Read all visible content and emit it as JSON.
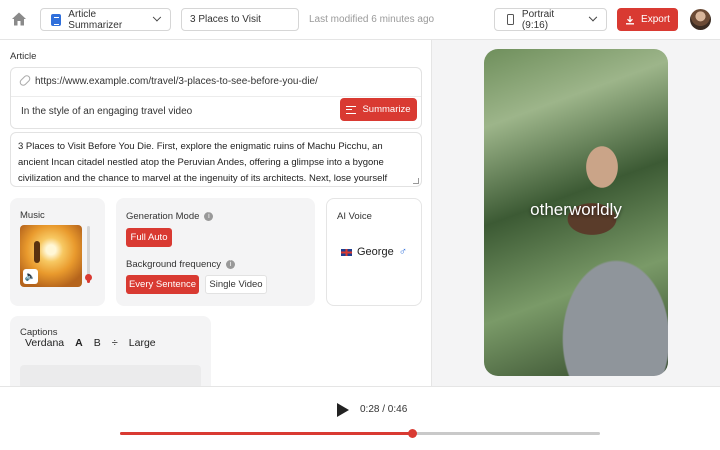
{
  "colors": {
    "accent": "#d93a32",
    "link": "#2f6fdb"
  },
  "header": {
    "tool": "Article Summarizer",
    "project_title": "3 Places to Visit",
    "modified": "Last modified 6 minutes ago",
    "aspect": "Portrait (9:16)",
    "export_label": "Export"
  },
  "article": {
    "label": "Article",
    "url": "https://www.example.com/travel/3-places-to-see-before-you-die/",
    "style": "In the style of an engaging travel video",
    "summarize_label": "Summarize",
    "text": "3 Places to Visit Before You Die. First, explore the enigmatic ruins of Machu Picchu, an ancient Incan citadel nestled atop the Peruvian Andes, offering a glimpse into a bygone civilization and the chance to marvel at the ingenuity of its architects. Next, lose yourself"
  },
  "music": {
    "label": "Music",
    "volume": 0.1
  },
  "generation": {
    "mode_label": "Generation Mode",
    "mode_selected": "Full Auto",
    "bg_label": "Background frequency",
    "bg_options": [
      "Every Sentence",
      "Single Video"
    ],
    "bg_selected": "Every Sentence"
  },
  "voice": {
    "label": "AI Voice",
    "name": "George",
    "gender_symbol": "♂"
  },
  "captions": {
    "label": "Captions",
    "font": "Verdana",
    "size": "Large"
  },
  "preview": {
    "caption": "otherworldly"
  },
  "player": {
    "time": "0:28 / 0:46",
    "progress": 0.6087
  }
}
